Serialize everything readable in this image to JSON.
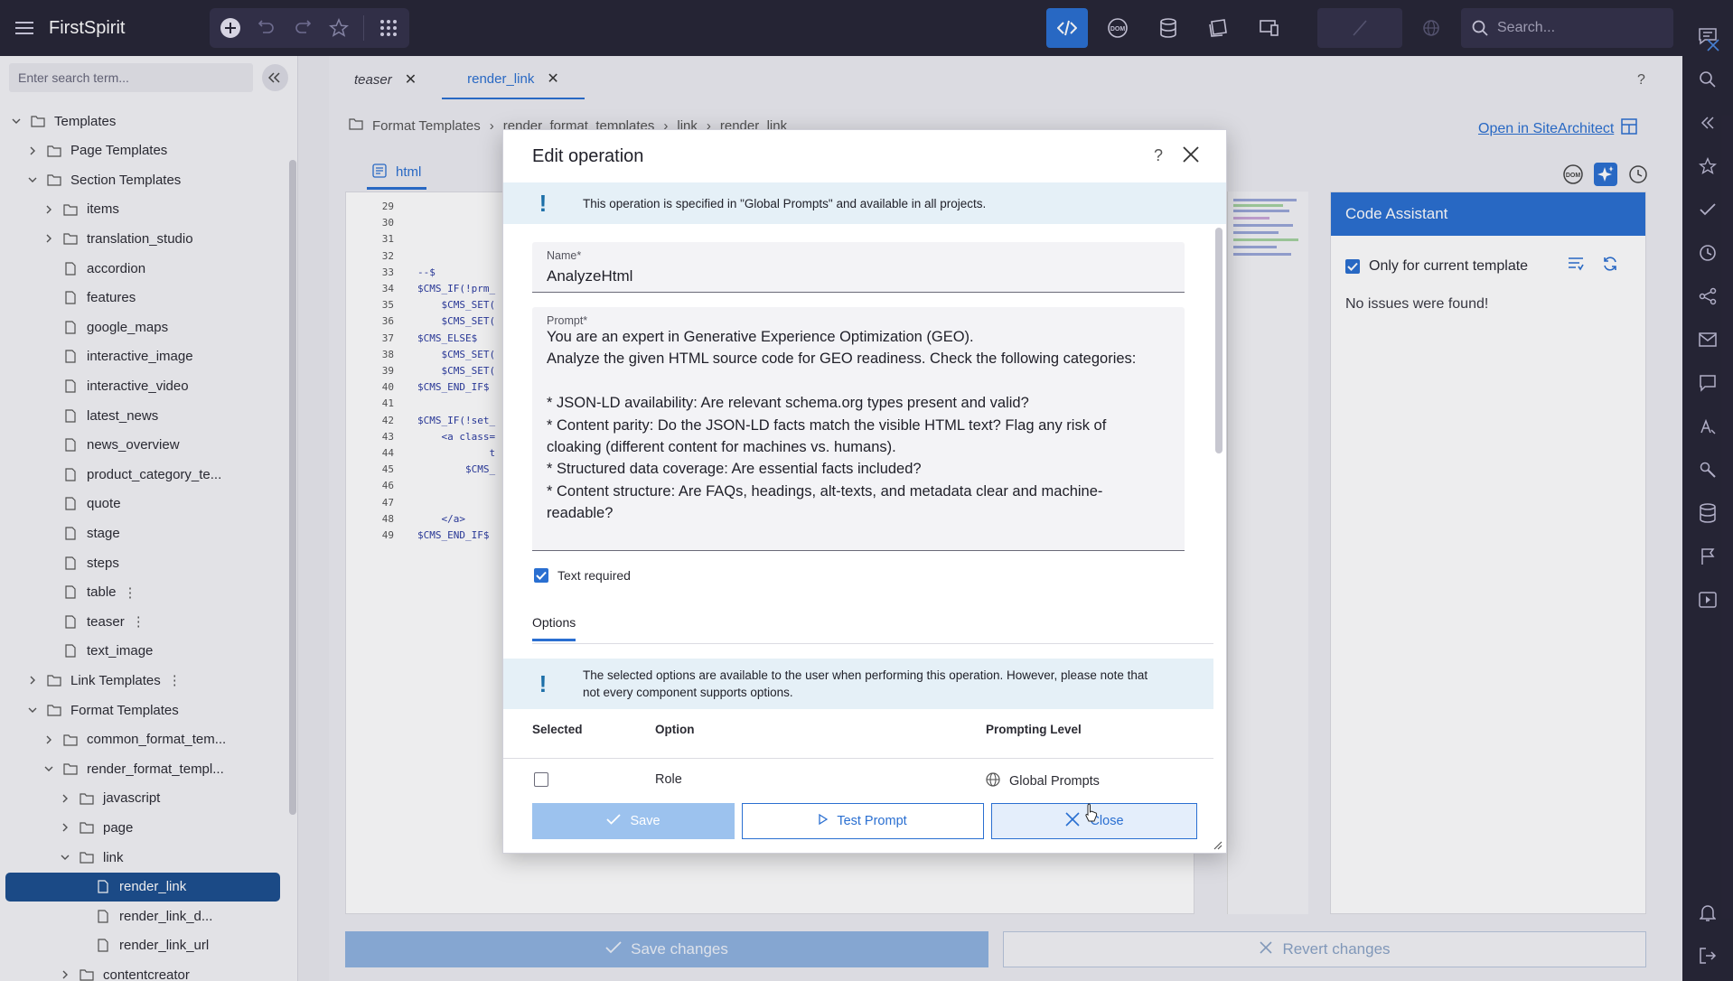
{
  "app": {
    "title": "FirstSpirit",
    "search_placeholder": "Search..."
  },
  "left_panel": {
    "search_placeholder": "Enter search term...",
    "tree": [
      {
        "label": "Templates",
        "level": 0,
        "type": "folder",
        "expanded": true
      },
      {
        "label": "Page Templates",
        "level": 1,
        "type": "folder",
        "expanded": false
      },
      {
        "label": "Section Templates",
        "level": 1,
        "type": "folder",
        "expanded": true
      },
      {
        "label": "items",
        "level": 2,
        "type": "folder",
        "expanded": false
      },
      {
        "label": "translation_studio",
        "level": 2,
        "type": "folder",
        "expanded": false
      },
      {
        "label": "accordion",
        "level": 2,
        "type": "file"
      },
      {
        "label": "features",
        "level": 2,
        "type": "file"
      },
      {
        "label": "google_maps",
        "level": 2,
        "type": "file"
      },
      {
        "label": "interactive_image",
        "level": 2,
        "type": "file"
      },
      {
        "label": "interactive_video",
        "level": 2,
        "type": "file"
      },
      {
        "label": "latest_news",
        "level": 2,
        "type": "file"
      },
      {
        "label": "news_overview",
        "level": 2,
        "type": "file"
      },
      {
        "label": "product_category_te...",
        "level": 2,
        "type": "file"
      },
      {
        "label": "quote",
        "level": 2,
        "type": "file"
      },
      {
        "label": "stage",
        "level": 2,
        "type": "file"
      },
      {
        "label": "steps",
        "level": 2,
        "type": "file"
      },
      {
        "label": "table",
        "level": 2,
        "type": "file",
        "more": true
      },
      {
        "label": "teaser",
        "level": 2,
        "type": "file",
        "more": true
      },
      {
        "label": "text_image",
        "level": 2,
        "type": "file"
      },
      {
        "label": "Link Templates",
        "level": 1,
        "type": "folder",
        "expanded": false,
        "more": true
      },
      {
        "label": "Format Templates",
        "level": 1,
        "type": "folder",
        "expanded": true
      },
      {
        "label": "common_format_tem...",
        "level": 2,
        "type": "folder",
        "expanded": false
      },
      {
        "label": "render_format_templ...",
        "level": 2,
        "type": "folder",
        "expanded": true
      },
      {
        "label": "javascript",
        "level": 3,
        "type": "folder",
        "expanded": false
      },
      {
        "label": "page",
        "level": 3,
        "type": "folder",
        "expanded": false
      },
      {
        "label": "link",
        "level": 3,
        "type": "folder",
        "expanded": true
      },
      {
        "label": "render_link",
        "level": 4,
        "type": "file",
        "selected": true
      },
      {
        "label": "render_link_d...",
        "level": 4,
        "type": "file"
      },
      {
        "label": "render_link_url",
        "level": 4,
        "type": "file"
      },
      {
        "label": "contentcreator",
        "level": 3,
        "type": "folder",
        "expanded": false
      }
    ]
  },
  "tabs": [
    {
      "label": "teaser",
      "active": false
    },
    {
      "label": "render_link",
      "active": true
    }
  ],
  "breadcrumb": [
    "Format Templates",
    "render_format_templates",
    "link",
    "render_link"
  ],
  "open_in_sitearchitect": "Open in SiteArchitect",
  "editor": {
    "subtab": "html",
    "line_numbers": [
      "29",
      "30",
      "31",
      "32",
      "33",
      "34",
      "35",
      "36",
      "37",
      "38",
      "39",
      "40",
      "41",
      "42",
      "43",
      "44",
      "45",
      "46",
      "47",
      "48",
      "49"
    ],
    "code_lines": [
      "",
      "",
      "",
      "",
      "--$",
      "$CMS_IF(!prm_",
      "    $CMS_SET(",
      "    $CMS_SET(",
      "$CMS_ELSE$",
      "    $CMS_SET(",
      "    $CMS_SET(",
      "$CMS_END_IF$",
      "",
      "$CMS_IF(!set_",
      "    <a class=",
      "            t",
      "        $CMS_",
      "",
      "",
      "    </a>",
      "$CMS_END_IF$"
    ]
  },
  "code_assistant": {
    "title": "Code Assistant",
    "only_current_label": "Only for current template",
    "only_current_checked": true,
    "message": "No issues were found!"
  },
  "bottom_bar": {
    "save_changes": "Save changes",
    "revert_changes": "Revert changes"
  },
  "dialog": {
    "title": "Edit operation",
    "help": "?",
    "info_text": "This operation is specified in \"Global Prompts\" and available in all projects.",
    "name_label": "Name*",
    "name_value": "AnalyzeHtml",
    "prompt_label": "Prompt*",
    "prompt_lines": [
      "You are an expert in Generative Experience Optimization (GEO).",
      "Analyze the given HTML source code for GEO readiness. Check the following categories:",
      "",
      "* JSON-LD availability: Are relevant schema.org types present and valid?",
      "* Content parity: Do the JSON-LD facts match the visible HTML text? Flag any risk of",
      "cloaking (different content for machines vs. humans).",
      "* Structured data coverage: Are essential facts included?",
      "* Content structure: Are FAQs, headings, alt-texts, and metadata clear and machine-",
      "readable?"
    ],
    "text_required_label": "Text required",
    "text_required_checked": true,
    "options_tab": "Options",
    "options_info_line1": "The selected options are available to the user when performing this operation. However, please note that",
    "options_info_line2": "not every component supports options.",
    "table_headers": {
      "selected": "Selected",
      "option": "Option",
      "level": "Prompting Level"
    },
    "rows": [
      {
        "selected": false,
        "option": "Role",
        "level": "Global Prompts"
      }
    ],
    "buttons": {
      "save": "Save",
      "test": "Test Prompt",
      "close": "Close"
    }
  },
  "colors": {
    "topbar": "#272536",
    "accent": "#2a6fd1",
    "selected_tree": "#1c4f8f",
    "info_bg": "#e5f0f7"
  }
}
